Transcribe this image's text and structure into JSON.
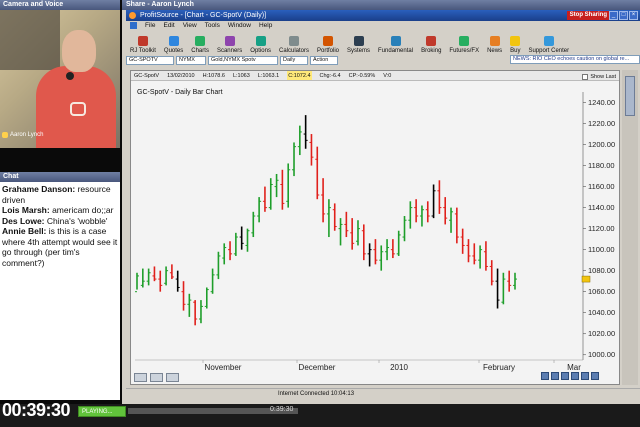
{
  "webinar": {
    "camera_panel_title": "Camera and Voice",
    "presenter_name": "Aaron Lynch",
    "chat_panel_title": "Chat",
    "chat_messages": [
      {
        "author": "Grahame Danson:",
        "text": "resource driven"
      },
      {
        "author": "Lois Marsh:",
        "text": "americam do;;ar"
      },
      {
        "author": "Des Lowe:",
        "text": "China's 'wobble'"
      },
      {
        "author": "Annie Bell:",
        "text": "is this is a case where 4th attempt would see it go through (per tim's comment?)"
      }
    ],
    "elapsed_time": "00:39:30",
    "playing_label": "PLAYING...",
    "time_right": "0:39:30"
  },
  "share": {
    "title": "Share - Aaron Lynch",
    "stop_label": "Stop Sharing"
  },
  "app": {
    "title": "ProfitSource - [Chart - GC-SpotV (Daily)]",
    "menu": [
      "File",
      "Edit",
      "View",
      "Tools",
      "Window",
      "Help"
    ],
    "toolbar": [
      {
        "label": "RJ Toolkit",
        "color": "#c0392b"
      },
      {
        "label": "Quotes",
        "color": "#2e86de"
      },
      {
        "label": "Charts",
        "color": "#27ae60"
      },
      {
        "label": "Scanners",
        "color": "#8e44ad"
      },
      {
        "label": "Options",
        "color": "#16a085"
      },
      {
        "label": "Calculators",
        "color": "#7f8c8d"
      },
      {
        "label": "Portfolio",
        "color": "#d35400"
      },
      {
        "label": "Systems",
        "color": "#2c3e50"
      },
      {
        "label": "Fundamental",
        "color": "#2980b9"
      },
      {
        "label": "Broking",
        "color": "#c0392b"
      },
      {
        "label": "Futures/FX",
        "color": "#27ae60"
      },
      {
        "label": "News",
        "color": "#e67e22"
      },
      {
        "label": "Buy",
        "color": "#f1c40f"
      },
      {
        "label": "Support Center",
        "color": "#3498db"
      }
    ],
    "symbol_combo": "GC-SPOTV",
    "exchange_combo": "NYMX",
    "name_combo": "Gold,NYMX Spotv",
    "period_combo": "Daily",
    "action_combo": "Action",
    "news": "NEWS: RIO CEO echoes caution on global re...",
    "status": "Internet Connected 10:04:13"
  },
  "chart_info": {
    "symbol": "GC-SpotV",
    "date": "13/02/2010",
    "high": "H:1078.6",
    "low": "L:1063",
    "close_prev": "L:1063.1",
    "close": "C:1072.4",
    "change": "Chg:-6.4",
    "change_pct": "CP:-0.59%",
    "volume": "V:0",
    "show_last": "Show Last"
  },
  "chart_data": {
    "type": "bar",
    "title": "GC-SpotV - Daily Bar Chart",
    "x_ticks": [
      "November",
      "December",
      "2010",
      "February",
      "Mar"
    ],
    "y_ticks": [
      1000,
      1020,
      1040,
      1060,
      1080,
      1100,
      1120,
      1140,
      1160,
      1180,
      1200,
      1220,
      1240
    ],
    "ylim": [
      995,
      1250
    ],
    "up_color": "#1e9e2a",
    "down_color": "#e0201b",
    "neutral_color": "#000000",
    "bars": [
      [
        1060,
        1078,
        1062,
        1075
      ],
      [
        1066,
        1082,
        1064,
        1070
      ],
      [
        1070,
        1082,
        1066,
        1078
      ],
      [
        1075,
        1084,
        1070,
        1072
      ],
      [
        1072,
        1080,
        1060,
        1066
      ],
      [
        1068,
        1084,
        1066,
        1080
      ],
      [
        1078,
        1086,
        1072,
        1074
      ],
      [
        1072,
        1080,
        1060,
        1064
      ],
      [
        1060,
        1070,
        1042,
        1048
      ],
      [
        1048,
        1058,
        1036,
        1052
      ],
      [
        1050,
        1052,
        1028,
        1034
      ],
      [
        1034,
        1052,
        1030,
        1046
      ],
      [
        1046,
        1064,
        1044,
        1062
      ],
      [
        1060,
        1082,
        1058,
        1076
      ],
      [
        1076,
        1098,
        1072,
        1094
      ],
      [
        1092,
        1106,
        1086,
        1102
      ],
      [
        1100,
        1108,
        1090,
        1096
      ],
      [
        1096,
        1116,
        1094,
        1112
      ],
      [
        1112,
        1122,
        1100,
        1106
      ],
      [
        1104,
        1120,
        1098,
        1118
      ],
      [
        1116,
        1136,
        1112,
        1132
      ],
      [
        1132,
        1150,
        1126,
        1146
      ],
      [
        1146,
        1160,
        1136,
        1140
      ],
      [
        1140,
        1168,
        1138,
        1162
      ],
      [
        1160,
        1172,
        1150,
        1166
      ],
      [
        1162,
        1176,
        1138,
        1144
      ],
      [
        1146,
        1182,
        1140,
        1176
      ],
      [
        1176,
        1202,
        1170,
        1198
      ],
      [
        1198,
        1218,
        1190,
        1212
      ],
      [
        1210,
        1228,
        1196,
        1204
      ],
      [
        1202,
        1210,
        1180,
        1188
      ],
      [
        1186,
        1198,
        1148,
        1152
      ],
      [
        1152,
        1168,
        1126,
        1134
      ],
      [
        1134,
        1148,
        1112,
        1140
      ],
      [
        1138,
        1144,
        1118,
        1122
      ],
      [
        1120,
        1130,
        1104,
        1124
      ],
      [
        1124,
        1136,
        1112,
        1118
      ],
      [
        1116,
        1130,
        1100,
        1106
      ],
      [
        1108,
        1128,
        1104,
        1120
      ],
      [
        1118,
        1124,
        1090,
        1096
      ],
      [
        1096,
        1106,
        1084,
        1100
      ],
      [
        1100,
        1110,
        1086,
        1090
      ],
      [
        1090,
        1104,
        1080,
        1098
      ],
      [
        1098,
        1110,
        1090,
        1102
      ],
      [
        1100,
        1110,
        1092,
        1096
      ],
      [
        1096,
        1118,
        1094,
        1114
      ],
      [
        1112,
        1132,
        1108,
        1128
      ],
      [
        1128,
        1146,
        1120,
        1140
      ],
      [
        1140,
        1148,
        1126,
        1132
      ],
      [
        1132,
        1142,
        1122,
        1138
      ],
      [
        1138,
        1146,
        1126,
        1132
      ],
      [
        1132,
        1162,
        1130,
        1156
      ],
      [
        1156,
        1166,
        1134,
        1140
      ],
      [
        1140,
        1150,
        1124,
        1130
      ],
      [
        1128,
        1140,
        1116,
        1136
      ],
      [
        1134,
        1140,
        1106,
        1112
      ],
      [
        1112,
        1120,
        1096,
        1104
      ],
      [
        1104,
        1110,
        1088,
        1094
      ],
      [
        1094,
        1106,
        1086,
        1090
      ],
      [
        1090,
        1104,
        1082,
        1100
      ],
      [
        1098,
        1108,
        1080,
        1084
      ],
      [
        1084,
        1090,
        1066,
        1070
      ],
      [
        1070,
        1082,
        1044,
        1052
      ],
      [
        1050,
        1078,
        1048,
        1072
      ],
      [
        1070,
        1080,
        1060,
        1066
      ],
      [
        1066,
        1078,
        1062,
        1072
      ]
    ]
  }
}
